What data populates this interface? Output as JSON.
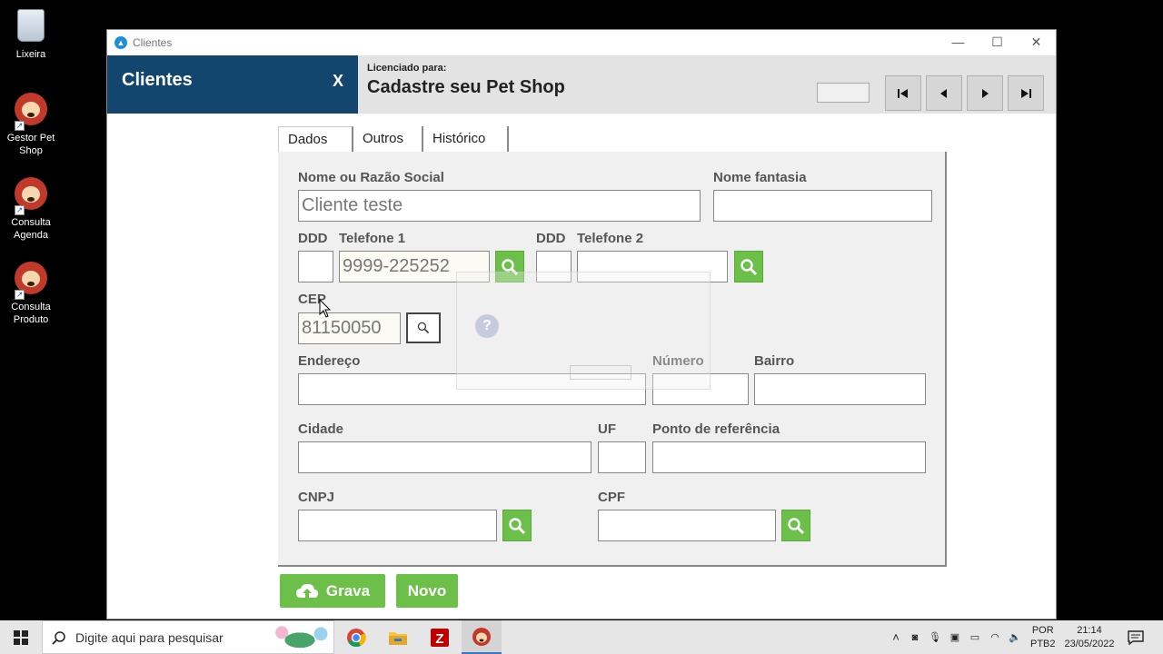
{
  "desktop": {
    "icons": [
      {
        "label": "Lixeira"
      },
      {
        "label": "Gestor Pet Shop"
      },
      {
        "label": "Consulta Agenda"
      },
      {
        "label": "Consulta Produto"
      }
    ]
  },
  "window": {
    "title": "Clientes",
    "controls": {
      "minimize": "—",
      "maximize": "☐",
      "close": "✕"
    }
  },
  "header": {
    "panel_title": "Clientes",
    "close_label": "X",
    "licensed_label": "Licenciado para:",
    "licensed_name": "Cadastre seu Pet Shop",
    "record_field": ""
  },
  "tabs": [
    {
      "label": "Dados",
      "active": true
    },
    {
      "label": "Outros",
      "active": false
    },
    {
      "label": "Histórico",
      "active": false
    }
  ],
  "form": {
    "labels": {
      "nome": "Nome  ou Razão Social",
      "fantasia": "Nome fantasia",
      "ddd1": "DDD",
      "tel1": "Telefone 1",
      "ddd2": "DDD",
      "tel2": "Telefone 2",
      "cep": "CEP",
      "endereco": "Endereço",
      "numero": "Número",
      "bairro": "Bairro",
      "cidade": "Cidade",
      "uf": "UF",
      "referencia": "Ponto de referência",
      "cnpj": "CNPJ",
      "cpf": "CPF"
    },
    "values": {
      "nome": "Cliente teste",
      "fantasia": "",
      "ddd1": "",
      "tel1": "9999-225252",
      "ddd2": "",
      "tel2": "",
      "cep": "81150050",
      "endereco": "",
      "numero": "",
      "bairro": "",
      "cidade": "",
      "uf": "",
      "referencia": "",
      "cnpj": "",
      "cpf": ""
    }
  },
  "actions": {
    "grava": "Grava",
    "novo": "Novo"
  },
  "taskbar": {
    "search_placeholder": "Digite aqui para pesquisar",
    "lang_top": "POR",
    "lang_bottom": "PTB2",
    "time": "21:14",
    "date": "23/05/2022"
  },
  "colors": {
    "header_blue": "#12466f",
    "green": "#6cc04a"
  }
}
